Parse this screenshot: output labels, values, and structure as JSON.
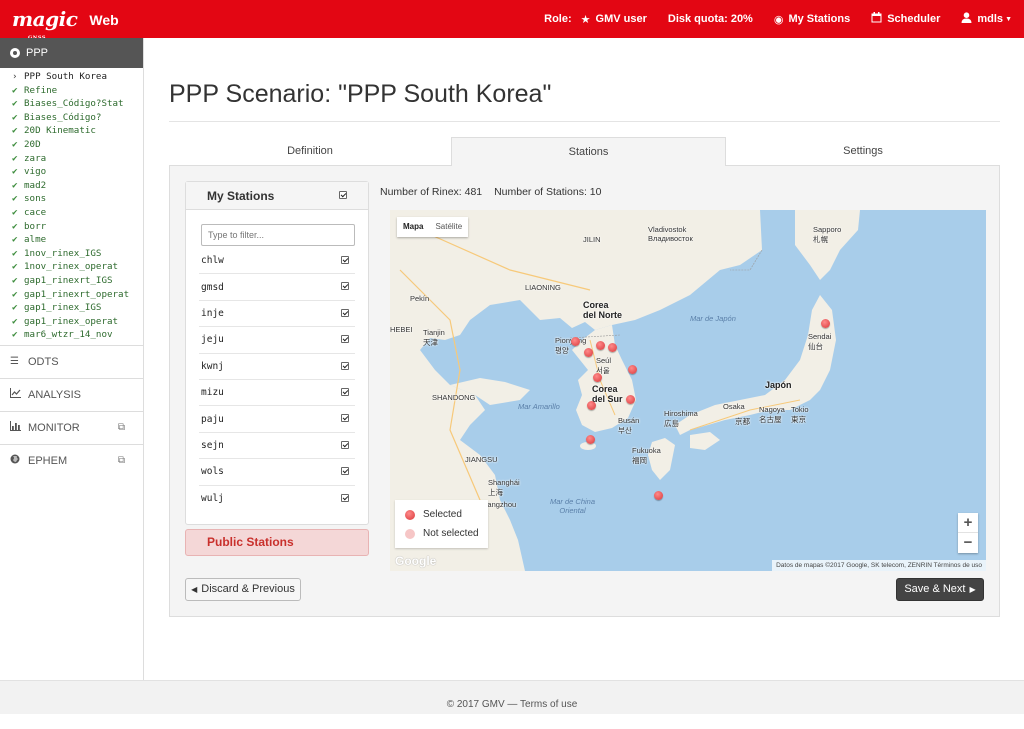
{
  "brand": {
    "logo": "magic",
    "logo_sub": "GNSS",
    "app": "Web"
  },
  "navbar": {
    "role_label": "Role:",
    "role_value": "GMV user",
    "disk_quota": "Disk quota: 20%",
    "my_stations": "My Stations",
    "scheduler": "Scheduler",
    "user": "mdls"
  },
  "sidebar": {
    "header": "PPP",
    "tree": [
      "PPP South Korea",
      "Refine",
      "Biases_Código?Stat",
      "Biases_Código?",
      "20D Kinematic",
      "20D",
      "zara",
      "vigo",
      "mad2",
      "sons",
      "cace",
      "borr",
      "alme",
      "1nov_rinex_IGS",
      "1nov_rinex_operat",
      "gap1_rinexrt_IGS",
      "gap1_rinexrt_operat",
      "gap1_rinex_IGS",
      "gap1_rinex_operat",
      "mar6_wtzr_14_nov"
    ],
    "sections": [
      "ODTS",
      "ANALYSIS",
      "MONITOR",
      "EPHEM"
    ]
  },
  "page": {
    "title": "PPP Scenario: \"PPP South Korea\""
  },
  "tabs": [
    "Definition",
    "Stations",
    "Settings"
  ],
  "stations": {
    "header": "My Stations",
    "filter_placeholder": "Type to filter...",
    "list": [
      "chlw",
      "gmsd",
      "inje",
      "jeju",
      "kwnj",
      "mizu",
      "paju",
      "sejn",
      "wols",
      "wulj"
    ],
    "public_label": "Public Stations"
  },
  "counts": {
    "rinex": "Number of Rinex: 481",
    "stations": "Number of Stations: 10"
  },
  "map": {
    "type_map": "Mapa",
    "type_sat": "Satélite",
    "legend_selected": "Selected",
    "legend_not_selected": "Not selected",
    "zoom_in": "+",
    "zoom_out": "−",
    "google": "Google",
    "attribution": "Datos de mapas ©2017 Google, SK telecom, ZENRIN   Términos de uso",
    "labels": {
      "jilin": "JILIN",
      "vladivostok": "Vladivostok\nВладивосток",
      "sapporo": "Sapporo\n札幌",
      "liaoning": "LIAONING",
      "pekin": "Pekín",
      "hebei": "HEBEI",
      "tianjin": "Tianjin\n天津",
      "corea_norte": "Corea\ndel Norte",
      "pionyang": "Pionyang\n평양",
      "seul": "Seúl\n서울",
      "mar_japon": "Mar de Japón",
      "sendai": "Sendai\n仙台",
      "japon": "Japón",
      "shandong": "SHANDONG",
      "mar_amarillo": "Mar Amarillo",
      "corea_sur": "Corea\ndel Sur",
      "busan": "Busán\n부산",
      "hiroshima": "Hiroshima\n広島",
      "osaka": "Osaka",
      "nagoya": "Nagoya\n名古屋",
      "tokyo": "Tokio\n東京",
      "jiangsu": "JIANGSU",
      "shanghai": "Shanghái\n上海",
      "fukuoka": "Fukuoka\n福岡",
      "hangzhou": "Hangzhou",
      "mar_china": "Mar de China\nOriental",
      "kyoto": "京都"
    }
  },
  "buttons": {
    "prev": "Discard & Previous",
    "next": "Save & Next"
  },
  "footer": "© 2017 GMV — Terms of use",
  "colors": {
    "brand_red": "#e30613",
    "marker": "#d9383a"
  }
}
